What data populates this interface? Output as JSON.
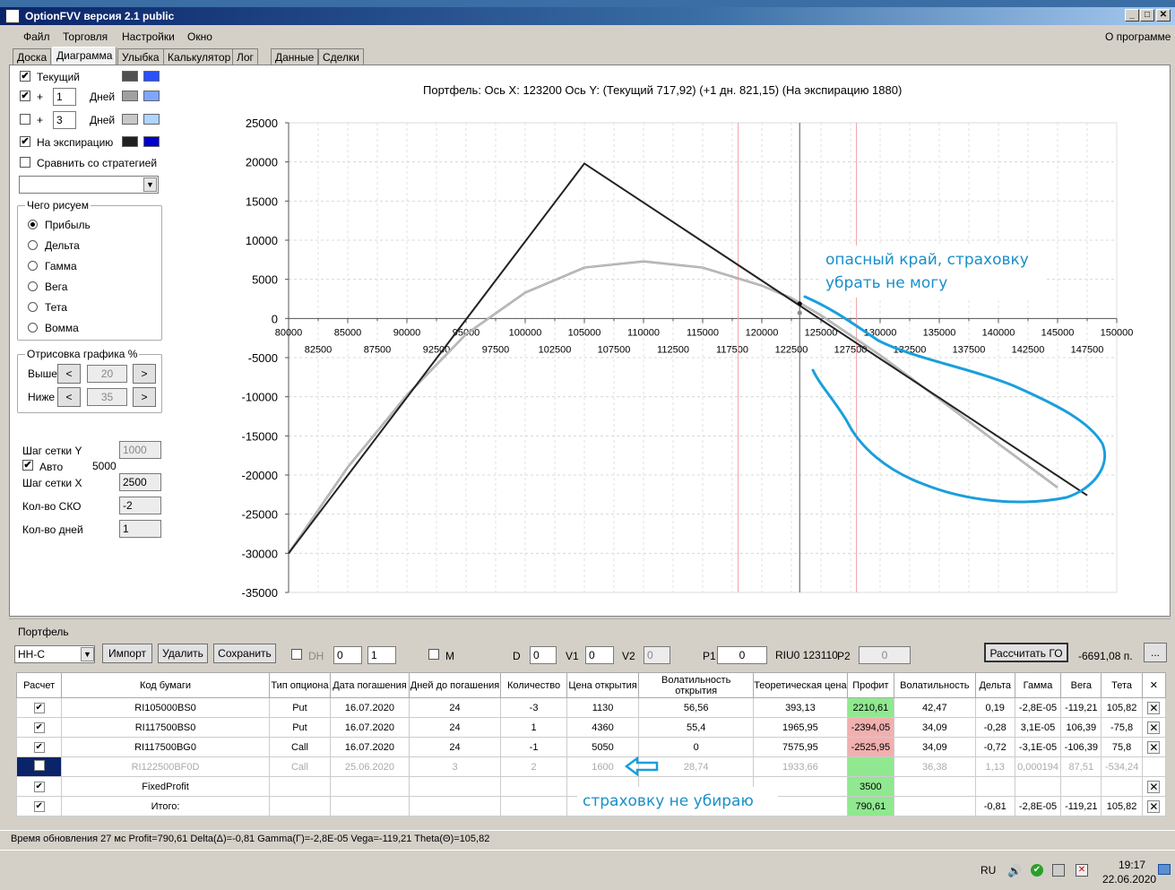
{
  "window": {
    "title": "OptionFVV версия 2.1 public",
    "about": "О программе"
  },
  "menu": [
    "Файл",
    "Торговля",
    "Настройки",
    "Окно"
  ],
  "tabs": [
    "Доска",
    "Диаграмма",
    "Улыбка",
    "Калькулятор",
    "Лог",
    "Данные",
    "Сделки"
  ],
  "left": {
    "current": "Текущий",
    "plus": "+",
    "days1": "1",
    "days_label": "Дней",
    "days2": "3",
    "expiration": "На экспирацию",
    "compare": "Сравнить со стратегией",
    "draw_group": "Чего рисуем",
    "draw_options": [
      "Прибыль",
      "Дельта",
      "Гамма",
      "Вега",
      "Тета",
      "Вомма"
    ],
    "render_group": "Отрисовка графика %",
    "above": "Выше",
    "above_val": "20",
    "below": "Ниже",
    "below_val": "35",
    "left_arrow": "<",
    "right_arrow": ">",
    "grid_y": "Шаг сетки Y",
    "grid_y_val": "1000",
    "auto": "Авто",
    "auto_val": "5000",
    "grid_x": "Шаг сетки X",
    "grid_x_val": "2500",
    "sko": "Кол-во СКО",
    "sko_val": "-2",
    "ndays": "Кол-во дней",
    "ndays_val": "1"
  },
  "colors": {
    "current_dark": "#505050",
    "current_light": "#2a50ff",
    "plus1_dark": "#a0a0a0",
    "plus1_light": "#7fa6ff",
    "plus3_dark": "#c8c8c8",
    "plus3_light": "#aed4ff",
    "exp_dark": "#202020",
    "exp_light": "#0000cc",
    "annotation": "#1a9fdc"
  },
  "chart_title": "Портфель:  Ось X: 123200 Ось Y:  (Текущий 717,92)  (+1 дн. 821,15)  (На экспирацию 1880)",
  "chart_data": {
    "type": "line",
    "ylim": [
      -35000,
      25000
    ],
    "xlim": [
      80000,
      150000
    ],
    "y_ticks": [
      "25000",
      "20000",
      "15000",
      "10000",
      "5000",
      "0",
      "-5000",
      "-10000",
      "-15000",
      "-20000",
      "-25000",
      "-30000",
      "-35000"
    ],
    "x_ticks_top": [
      "80000",
      "85000",
      "90000",
      "95000",
      "100000",
      "105000",
      "110000",
      "115000",
      "120000",
      "125000",
      "130000",
      "135000",
      "140000",
      "145000",
      "150000"
    ],
    "x_ticks_bottom": [
      "82500",
      "87500",
      "92500",
      "97500",
      "102500",
      "107500",
      "112500",
      "117500",
      "122500",
      "127500",
      "132500",
      "137500",
      "142500",
      "147500"
    ],
    "series": [
      {
        "x": [
          80000,
          105000,
          147500
        ],
        "y": [
          -30000,
          19800,
          -22600
        ]
      },
      {
        "x": [
          80000,
          85000,
          90000,
          95000,
          100000,
          105000,
          110000,
          115000,
          120000,
          122500,
          125000,
          130000,
          135000,
          140000,
          145000
        ],
        "y": [
          -30000,
          -19000,
          -9800,
          -2000,
          3300,
          6500,
          7300,
          6500,
          4200,
          2600,
          400,
          -4700,
          -10300,
          -16000,
          -21600
        ]
      }
    ],
    "cursor_x": 123200,
    "red_lines_x": [
      118000,
      128000
    ]
  },
  "annotations": {
    "top": "опасный край, страховку убрать не могу",
    "bottom": "страховку не убираю"
  },
  "portfolio": {
    "group": "Портфель",
    "select": "НН-С",
    "import": "Импорт",
    "delete": "Удалить",
    "save": "Сохранить",
    "dh": "DH",
    "dh_val1": "0",
    "dh_val2": "1",
    "m": "M",
    "d": "D",
    "d_val": "0",
    "v1": "V1",
    "v1_val": "0",
    "v2": "V2",
    "v2_val": "0",
    "p1": "P1",
    "p1_val": "0",
    "riu": "RIU0 123110",
    "p2": "P2",
    "p2_val": "0",
    "calc_go": "Рассчитать ГО",
    "go_val": "-6691,08 п.",
    "dots": "..."
  },
  "table": {
    "headers": [
      "Расчет",
      "Код бумаги",
      "Тип опциона",
      "Дата погашения",
      "Дней до погашения",
      "Количество",
      "Цена открытия",
      "Волатильность открытия",
      "Теоретическая цена",
      "Профит",
      "Волатильность",
      "Дельта",
      "Гамма",
      "Вега",
      "Тета",
      "✕"
    ],
    "rows": [
      {
        "check": "✔",
        "code": "RI105000BS0",
        "type": "Put",
        "date": "16.07.2020",
        "days": "24",
        "qty": "-3",
        "price": "1130",
        "vol_open": "56,56",
        "theo": "393,13",
        "profit": "2210,61",
        "vol": "42,47",
        "delta": "0,19",
        "gamma": "-2,8E-05",
        "vega": "-119,21",
        "theta": "105,82"
      },
      {
        "check": "✔",
        "code": "RI117500BS0",
        "type": "Put",
        "date": "16.07.2020",
        "days": "24",
        "qty": "1",
        "price": "4360",
        "vol_open": "55,4",
        "theo": "1965,95",
        "profit": "-2394,05",
        "vol": "34,09",
        "delta": "-0,28",
        "gamma": "3,1E-05",
        "vega": "106,39",
        "theta": "-75,8"
      },
      {
        "check": "✔",
        "code": "RI117500BG0",
        "type": "Call",
        "date": "16.07.2020",
        "days": "24",
        "qty": "-1",
        "price": "5050",
        "vol_open": "0",
        "theo": "7575,95",
        "profit": "-2525,95",
        "vol": "34,09",
        "delta": "-0,72",
        "gamma": "-3,1E-05",
        "vega": "-106,39",
        "theta": "75,8"
      },
      {
        "check": "",
        "code": "RI122500BF0D",
        "type": "Call",
        "date": "25.06.2020",
        "days": "3",
        "qty": "2",
        "price": "1600",
        "vol_open": "28,74",
        "theo": "1933,66",
        "profit": "",
        "vol": "36,38",
        "delta": "1,13",
        "gamma": "0,000194",
        "vega": "87,51",
        "theta": "-534,24"
      },
      {
        "check": "✔",
        "code": "FixedProfit",
        "type": "",
        "date": "",
        "days": "",
        "qty": "",
        "price": "",
        "vol_open": "",
        "theo": "",
        "profit": "3500",
        "vol": "",
        "delta": "",
        "gamma": "",
        "vega": "",
        "theta": ""
      },
      {
        "check": "✔",
        "code": "Итого:",
        "type": "",
        "date": "",
        "days": "",
        "qty": "",
        "price": "",
        "vol_open": "",
        "theo": "",
        "profit": "790,61",
        "vol": "",
        "delta": "-0,81",
        "gamma": "-2,8E-05",
        "vega": "-119,21",
        "theta": "105,82"
      }
    ]
  },
  "status": "Время обновления 27 мс  Profit=790,61 Delta(Δ)=-0,81 Gamma(Γ)=-2,8E-05 Vega=-119,21 Theta(Θ)=105,82",
  "taskbar": {
    "lang": "RU",
    "time": "19:17",
    "date": "22.06.2020"
  }
}
